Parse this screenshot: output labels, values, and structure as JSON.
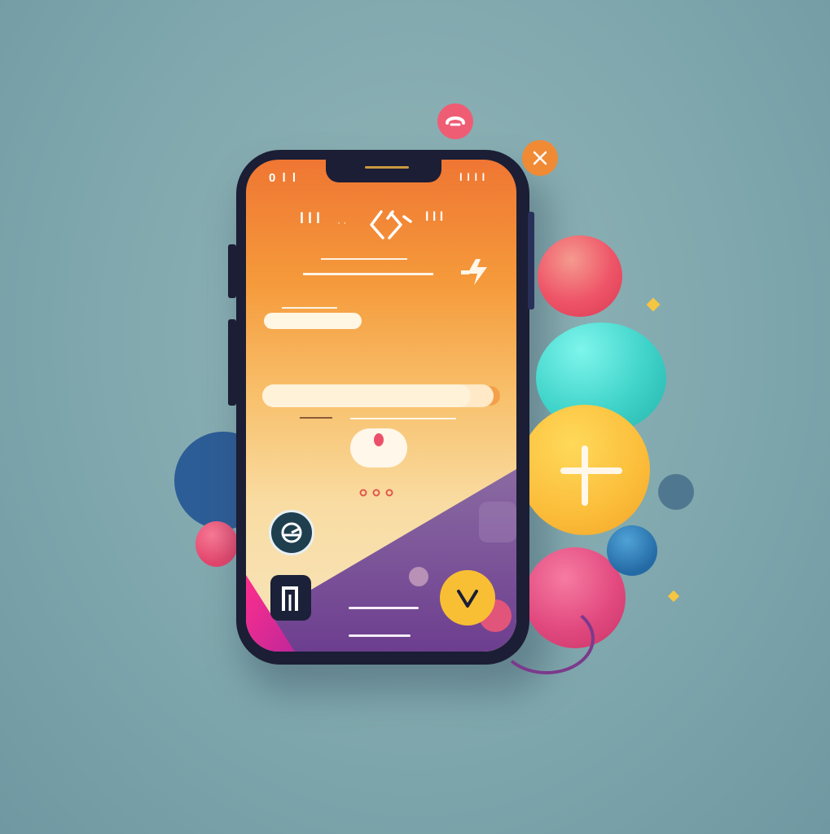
{
  "status_bar": {
    "left": "0 l l",
    "right": "l l l l"
  },
  "header": {
    "left": "l l l",
    "right": "l l l"
  },
  "colors": {
    "background": "#88aeb3",
    "phone_frame": "#1b1e35",
    "screen_top": "#ef7633",
    "screen_bottom": "#f6e4bd",
    "accent_yellow": "#f8bf34",
    "accent_pink": "#e24a7f",
    "accent_teal": "#3fd3c9",
    "accent_purple": "#6d3e8f"
  },
  "icons": {
    "top_pink_bubble": "heart-icon",
    "top_orange_bubble": "close-icon",
    "yellow_bubble": "plus-icon",
    "header_symbol": "diamond-icon",
    "header_right_symbol": "logo-icon",
    "lightning": "lightning-icon",
    "circle_button": "chart-icon",
    "square_button": "bookmark-icon",
    "v_button": "chevron-down-icon"
  }
}
